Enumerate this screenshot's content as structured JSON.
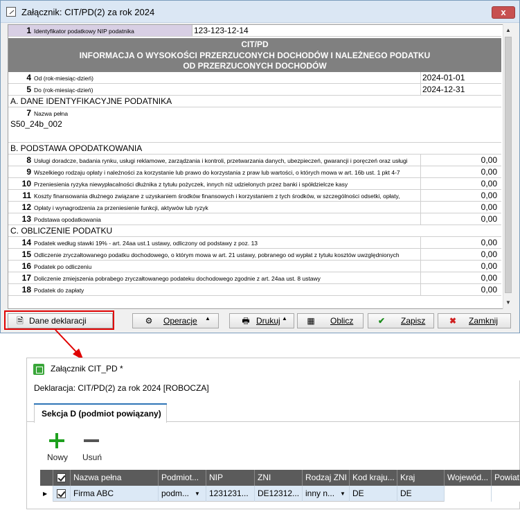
{
  "dialog": {
    "title": "Załącznik: CIT/PD(2) za rok 2024",
    "close": "x"
  },
  "form": {
    "nip_row": {
      "num": "1",
      "label": "Identyfikator podatkowy NIP podatnika",
      "value": "123-123-12-14"
    },
    "header": {
      "line1": "CIT/PD",
      "line2": "INFORMACJA O WYSOKOŚCI PRZERZUCONYCH DOCHODÓW I NALEŻNEGO PODATKU",
      "line3": "OD PRZERZUCONYCH DOCHODÓW"
    },
    "date_rows": [
      {
        "num": "4",
        "label": "Od (rok-miesiąc-dzień)",
        "value": "2024-01-01"
      },
      {
        "num": "5",
        "label": "Do (rok-miesiąc-dzień)",
        "value": "2024-12-31"
      }
    ],
    "section_a": "A. DANE IDENTYFIKACYJNE PODATNIKA",
    "name_row": {
      "num": "7",
      "label": "Nazwa pełna",
      "value": "S50_24b_002"
    },
    "section_b": "B. PODSTAWA OPODATKOWANIA",
    "b_rows": [
      {
        "num": "8",
        "label": "Usługi doradcze, badania rynku, usługi reklamowe, zarządzania i kontroli, przetwarzania danych, ubezpieczeń, gwarancji i poręczeń oraz usługi",
        "value": "0,00"
      },
      {
        "num": "9",
        "label": "Wszelkiego rodzaju opłaty i należności za korzystanie lub prawo do korzystania z praw lub wartości, o których mowa w art. 16b ust. 1 pkt 4-7",
        "value": "0,00"
      },
      {
        "num": "10",
        "label": "Przeniesienia ryzyka niewypłacalności dłużnika z tytułu pożyczek, innych niż udzielonych przez banki i spółdzielcze kasy",
        "value": "0,00"
      },
      {
        "num": "11",
        "label": "Koszty finansowania dłużnego związane z uzyskaniem środków finansowych i korzystaniem z tych środków, w szczególności odsetki, opłaty,",
        "value": "0,00"
      },
      {
        "num": "12",
        "label": "Opłaty i wynagrodzenia za przeniesienie funkcji, aktywów lub ryzyk",
        "value": "0,00"
      },
      {
        "num": "13",
        "label": "Podstawa opodatkowania",
        "value": "0,00"
      }
    ],
    "section_c": "C. OBLICZENIE PODATKU",
    "c_rows": [
      {
        "num": "14",
        "label": "Podatek według stawki 19% - art. 24aa ust.1 ustawy, odliczony od podstawy z poz. 13",
        "value": "0,00"
      },
      {
        "num": "15",
        "label": "Odliczenie zryczałtowanego podatku dochodowego, o którym mowa w art. 21 ustawy, pobranego od wypłat z tytułu kosztów uwzględnionych",
        "value": "0,00"
      },
      {
        "num": "16",
        "label": "Podatek po odliczeniu",
        "value": "0,00"
      },
      {
        "num": "17",
        "label": "Doliczenie zmiejszenia pobrabego zryczałtowanego podateku dochodowego zgodnie z art. 24aa ust. 8 ustawy",
        "value": "0,00"
      },
      {
        "num": "18",
        "label": "Podatek do zapłaty",
        "value": "0,00"
      }
    ]
  },
  "buttons": {
    "dane": "Dane deklaracji",
    "operacje": "Operacje",
    "drukuj": "Drukuj",
    "oblicz": "Oblicz",
    "zapisz": "Zapisz",
    "zamknij": "Zamknij"
  },
  "window2": {
    "title": "Załącznik CIT_PD *",
    "declaration": "Deklaracja:  CIT/PD(2) za rok 2024 [ROBOCZA]",
    "tab": "Sekcja D (podmiot powiązany)",
    "toolbar": {
      "new": "Nowy",
      "delete": "Usuń"
    },
    "columns": [
      "Nazwa pełna",
      "Podmiot...",
      "NIP",
      "ZNI",
      "Rodzaj ZNI",
      "Kod kraju...",
      "Kraj",
      "Wojewód...",
      "Powiat"
    ],
    "row": {
      "nazwa": "Firma ABC",
      "podmiot": "podm...",
      "nip": "1231231...",
      "zni": "DE12312...",
      "rodzaj": "inny n...",
      "kod": "DE",
      "kraj": "DE",
      "wojew": "",
      "powiat": ""
    }
  },
  "colors": {
    "highlight_red": "#e00000",
    "accent_blue": "#2e75b6",
    "header_gray": "#808080"
  }
}
